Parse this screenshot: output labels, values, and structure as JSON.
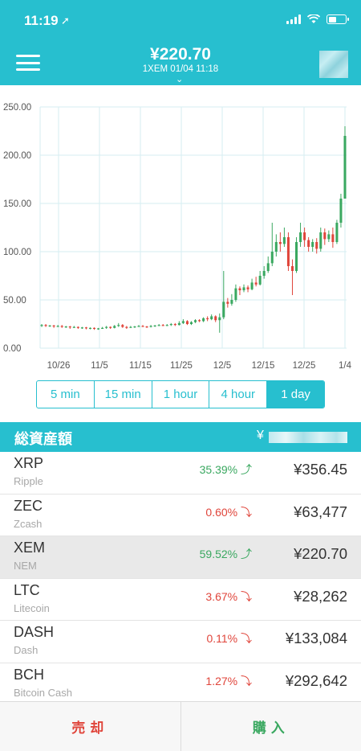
{
  "status_bar": {
    "time": "11:19",
    "location_icon": "location-arrow-icon"
  },
  "header": {
    "price": "¥220.70",
    "subtitle": "1XEM  01/04 11:18",
    "menu_icon": "hamburger-icon",
    "chevron_icon": "chevron-down-icon"
  },
  "chart_data": {
    "type": "candlestick",
    "y_ticks": [
      "250.00",
      "200.00",
      "150.00",
      "100.00",
      "50.00",
      "0.00"
    ],
    "ylim": [
      0,
      250
    ],
    "x_ticks": [
      "10/26",
      "11/5",
      "11/15",
      "11/25",
      "12/5",
      "12/15",
      "12/25",
      "1/4"
    ],
    "grid": true,
    "up_color": "#3aa860",
    "down_color": "#e0453b",
    "candles": [
      {
        "o": 23,
        "c": 24,
        "h": 25,
        "l": 22
      },
      {
        "o": 24,
        "c": 23,
        "h": 25,
        "l": 22
      },
      {
        "o": 23,
        "c": 23.5,
        "h": 24,
        "l": 22
      },
      {
        "o": 23.5,
        "c": 22.5,
        "h": 24,
        "l": 21
      },
      {
        "o": 22.5,
        "c": 23,
        "h": 24,
        "l": 22
      },
      {
        "o": 23,
        "c": 22,
        "h": 24,
        "l": 21
      },
      {
        "o": 22,
        "c": 22.5,
        "h": 23,
        "l": 21
      },
      {
        "o": 22.5,
        "c": 21.5,
        "h": 23,
        "l": 20
      },
      {
        "o": 21.5,
        "c": 22,
        "h": 23,
        "l": 21
      },
      {
        "o": 22,
        "c": 21,
        "h": 22.5,
        "l": 20
      },
      {
        "o": 21,
        "c": 21.5,
        "h": 22,
        "l": 20
      },
      {
        "o": 21.5,
        "c": 20.5,
        "h": 22,
        "l": 19.5
      },
      {
        "o": 20.5,
        "c": 21,
        "h": 21.5,
        "l": 19.5
      },
      {
        "o": 21,
        "c": 20,
        "h": 21.5,
        "l": 19
      },
      {
        "o": 20,
        "c": 20.5,
        "h": 21,
        "l": 19
      },
      {
        "o": 20.5,
        "c": 21,
        "h": 22,
        "l": 20
      },
      {
        "o": 21,
        "c": 22,
        "h": 23,
        "l": 20
      },
      {
        "o": 22,
        "c": 21,
        "h": 22.5,
        "l": 20
      },
      {
        "o": 21,
        "c": 23,
        "h": 24,
        "l": 20.5
      },
      {
        "o": 23,
        "c": 24,
        "h": 26,
        "l": 22
      },
      {
        "o": 24,
        "c": 22,
        "h": 25,
        "l": 21
      },
      {
        "o": 22,
        "c": 21.5,
        "h": 23,
        "l": 20
      },
      {
        "o": 21.5,
        "c": 22,
        "h": 23,
        "l": 21
      },
      {
        "o": 22,
        "c": 22.5,
        "h": 23,
        "l": 21
      },
      {
        "o": 22.5,
        "c": 23,
        "h": 24,
        "l": 22
      },
      {
        "o": 23,
        "c": 22.5,
        "h": 24,
        "l": 22
      },
      {
        "o": 22.5,
        "c": 22,
        "h": 23,
        "l": 21
      },
      {
        "o": 22,
        "c": 23,
        "h": 24,
        "l": 21.5
      },
      {
        "o": 23,
        "c": 23.5,
        "h": 24,
        "l": 22
      },
      {
        "o": 23.5,
        "c": 24,
        "h": 25,
        "l": 23
      },
      {
        "o": 24,
        "c": 23.5,
        "h": 25,
        "l": 23
      },
      {
        "o": 23.5,
        "c": 24,
        "h": 25,
        "l": 23
      },
      {
        "o": 24,
        "c": 25,
        "h": 26,
        "l": 23
      },
      {
        "o": 25,
        "c": 24,
        "h": 26,
        "l": 23
      },
      {
        "o": 24,
        "c": 26,
        "h": 28,
        "l": 23.5
      },
      {
        "o": 26,
        "c": 28,
        "h": 30,
        "l": 25
      },
      {
        "o": 28,
        "c": 25,
        "h": 29,
        "l": 24
      },
      {
        "o": 25,
        "c": 27,
        "h": 28,
        "l": 24
      },
      {
        "o": 27,
        "c": 29,
        "h": 30,
        "l": 26
      },
      {
        "o": 29,
        "c": 28,
        "h": 30,
        "l": 27
      },
      {
        "o": 28,
        "c": 31,
        "h": 32,
        "l": 27
      },
      {
        "o": 31,
        "c": 30,
        "h": 33,
        "l": 28
      },
      {
        "o": 30,
        "c": 33,
        "h": 35,
        "l": 29
      },
      {
        "o": 33,
        "c": 29,
        "h": 34,
        "l": 27
      },
      {
        "o": 29,
        "c": 32,
        "h": 36,
        "l": 16
      },
      {
        "o": 32,
        "c": 48,
        "h": 80,
        "l": 30
      },
      {
        "o": 48,
        "c": 46,
        "h": 52,
        "l": 42
      },
      {
        "o": 46,
        "c": 50,
        "h": 56,
        "l": 44
      },
      {
        "o": 50,
        "c": 62,
        "h": 66,
        "l": 48
      },
      {
        "o": 62,
        "c": 60,
        "h": 64,
        "l": 55
      },
      {
        "o": 60,
        "c": 63,
        "h": 66,
        "l": 58
      },
      {
        "o": 63,
        "c": 61,
        "h": 65,
        "l": 58
      },
      {
        "o": 61,
        "c": 68,
        "h": 72,
        "l": 60
      },
      {
        "o": 68,
        "c": 66,
        "h": 74,
        "l": 64
      },
      {
        "o": 66,
        "c": 75,
        "h": 80,
        "l": 65
      },
      {
        "o": 75,
        "c": 80,
        "h": 85,
        "l": 72
      },
      {
        "o": 80,
        "c": 88,
        "h": 95,
        "l": 78
      },
      {
        "o": 88,
        "c": 100,
        "h": 130,
        "l": 85
      },
      {
        "o": 100,
        "c": 110,
        "h": 118,
        "l": 95
      },
      {
        "o": 110,
        "c": 108,
        "h": 120,
        "l": 100
      },
      {
        "o": 108,
        "c": 115,
        "h": 125,
        "l": 105
      },
      {
        "o": 115,
        "c": 85,
        "h": 120,
        "l": 80
      },
      {
        "o": 85,
        "c": 80,
        "h": 92,
        "l": 55
      },
      {
        "o": 80,
        "c": 110,
        "h": 115,
        "l": 78
      },
      {
        "o": 110,
        "c": 120,
        "h": 130,
        "l": 105
      },
      {
        "o": 120,
        "c": 112,
        "h": 125,
        "l": 105
      },
      {
        "o": 112,
        "c": 105,
        "h": 115,
        "l": 100
      },
      {
        "o": 105,
        "c": 110,
        "h": 113,
        "l": 100
      },
      {
        "o": 110,
        "c": 103,
        "h": 114,
        "l": 98
      },
      {
        "o": 103,
        "c": 120,
        "h": 125,
        "l": 100
      },
      {
        "o": 120,
        "c": 113,
        "h": 124,
        "l": 107
      },
      {
        "o": 113,
        "c": 118,
        "h": 122,
        "l": 110
      },
      {
        "o": 118,
        "c": 110,
        "h": 125,
        "l": 104
      },
      {
        "o": 110,
        "c": 130,
        "h": 133,
        "l": 108
      },
      {
        "o": 130,
        "c": 155,
        "h": 160,
        "l": 125
      },
      {
        "o": 155,
        "c": 220,
        "h": 230,
        "l": 155
      }
    ]
  },
  "timeframes": [
    {
      "label": "5 min",
      "active": false
    },
    {
      "label": "15 min",
      "active": false
    },
    {
      "label": "1 hour",
      "active": false
    },
    {
      "label": "4 hour",
      "active": false
    },
    {
      "label": "1 day",
      "active": true
    }
  ],
  "assets": {
    "title": "総資産額",
    "yen_symbol": "¥"
  },
  "coins": [
    {
      "symbol": "XRP",
      "name": "Ripple",
      "change": "35.39%",
      "direction": "up",
      "price": "¥356.45",
      "selected": false
    },
    {
      "symbol": "ZEC",
      "name": "Zcash",
      "change": "0.60%",
      "direction": "down",
      "price": "¥63,477",
      "selected": false
    },
    {
      "symbol": "XEM",
      "name": "NEM",
      "change": "59.52%",
      "direction": "up",
      "price": "¥220.70",
      "selected": true
    },
    {
      "symbol": "LTC",
      "name": "Litecoin",
      "change": "3.67%",
      "direction": "down",
      "price": "¥28,262",
      "selected": false
    },
    {
      "symbol": "DASH",
      "name": "Dash",
      "change": "0.11%",
      "direction": "down",
      "price": "¥133,084",
      "selected": false
    },
    {
      "symbol": "BCH",
      "name": "Bitcoin Cash",
      "change": "1.27%",
      "direction": "down",
      "price": "¥292,642",
      "selected": false
    }
  ],
  "actions": {
    "sell": "売却",
    "buy": "購入"
  },
  "colors": {
    "accent": "#27bfcf",
    "up": "#3aa860",
    "down": "#e0453b"
  }
}
